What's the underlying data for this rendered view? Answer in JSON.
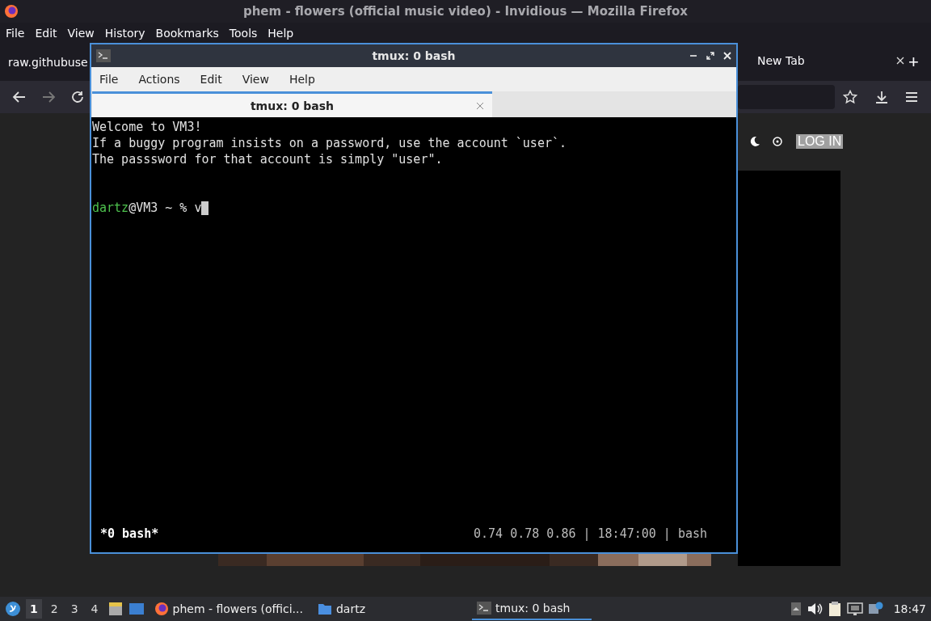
{
  "browser": {
    "title": "phem - flowers (official music video) - Invidious — Mozilla Firefox",
    "menu": [
      "File",
      "Edit",
      "View",
      "History",
      "Bookmarks",
      "Tools",
      "Help"
    ],
    "tabs": [
      {
        "label": "raw.githubuse",
        "selected": false
      },
      {
        "label": "New Tab",
        "selected": false
      }
    ],
    "new_tab": "+",
    "page": {
      "login": "LOG IN"
    }
  },
  "terminal": {
    "title": "tmux: 0 bash",
    "menu": [
      "File",
      "Actions",
      "Edit",
      "View",
      "Help"
    ],
    "tab": "tmux: 0 bash",
    "lines": [
      "Welcome to VM3!",
      "If a buggy program insists on a password, use the account `user`.",
      "The passsword for that account is simply \"user\"."
    ],
    "prompt": {
      "user": "dartz",
      "rest": "@VM3 ~ % ",
      "input": "v"
    },
    "status_left": "*0 bash*",
    "status_right": "0.74 0.78 0.86 | 18:47:00 | bash"
  },
  "taskbar": {
    "workspaces": [
      {
        "label": "1",
        "selected": true
      },
      {
        "label": "2",
        "selected": false
      },
      {
        "label": "3",
        "selected": false
      },
      {
        "label": "4",
        "selected": false
      }
    ],
    "tasks": [
      {
        "kind": "firefox",
        "label": "phem - flowers (offici...",
        "selected": false
      },
      {
        "kind": "folder",
        "label": "dartz",
        "selected": false
      },
      {
        "kind": "terminal",
        "label": "tmux: 0 bash",
        "selected": true
      }
    ],
    "clock": "18:47"
  }
}
